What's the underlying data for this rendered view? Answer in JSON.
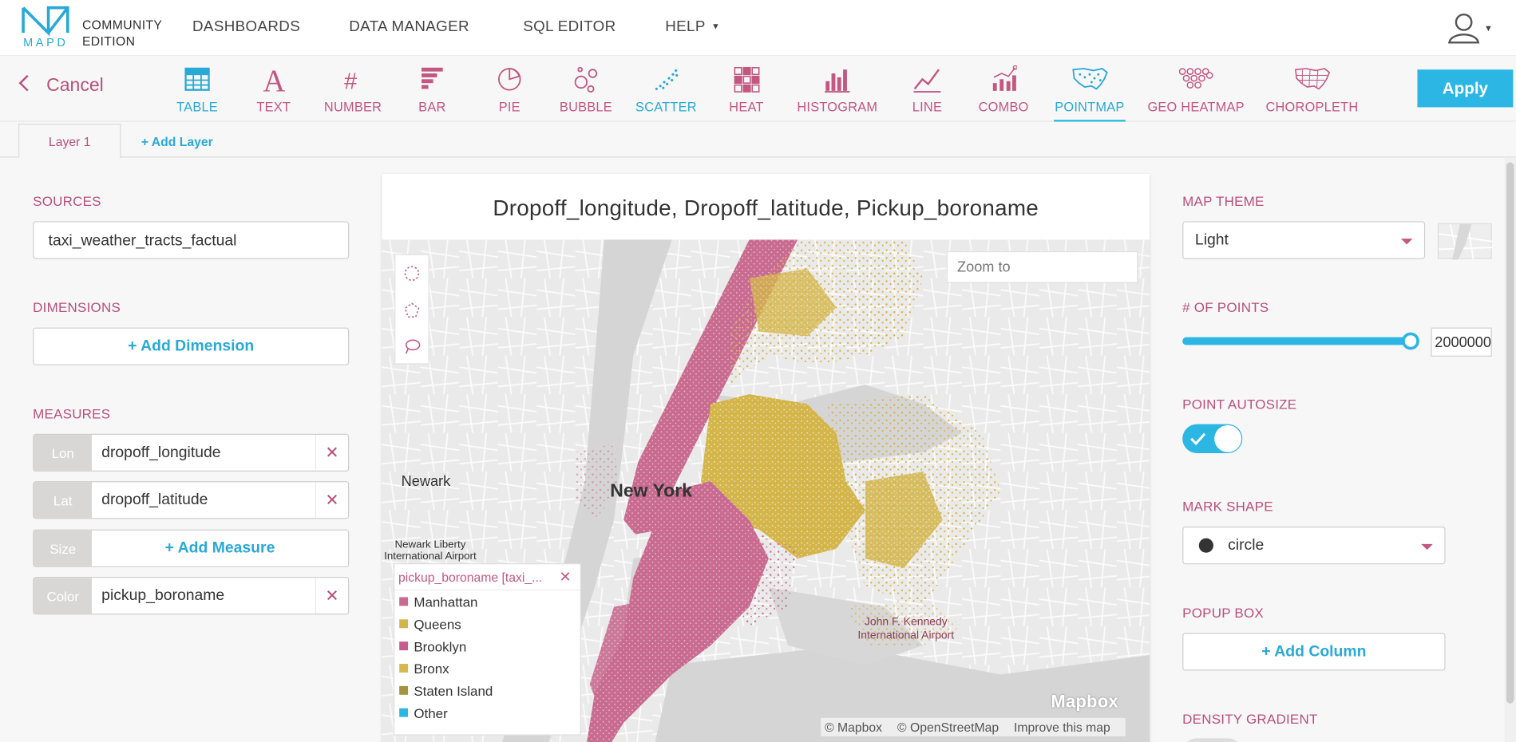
{
  "brand": {
    "logo_text": "MAPD",
    "edition_line1": "COMMUNITY",
    "edition_line2": "EDITION"
  },
  "nav": {
    "dashboards": "DASHBOARDS",
    "data_manager": "DATA MANAGER",
    "sql_editor": "SQL EDITOR",
    "help": "HELP"
  },
  "toolbar": {
    "cancel": "Cancel",
    "apply": "Apply",
    "chart_types": [
      "TABLE",
      "TEXT",
      "NUMBER",
      "BAR",
      "PIE",
      "BUBBLE",
      "SCATTER",
      "HEAT",
      "HISTOGRAM",
      "LINE",
      "COMBO",
      "POINTMAP",
      "GEO HEATMAP",
      "CHOROPLETH"
    ],
    "active": "POINTMAP"
  },
  "layers": {
    "tab": "Layer 1",
    "add": "+ Add Layer"
  },
  "left": {
    "sources_label": "SOURCES",
    "source": "taxi_weather_tracts_factual",
    "dimensions_label": "DIMENSIONS",
    "add_dimension": "+ Add Dimension",
    "measures_label": "MEASURES",
    "measures": [
      {
        "tag": "Lon",
        "value": "dropoff_longitude",
        "remove": "✕"
      },
      {
        "tag": "Lat",
        "value": "dropoff_latitude",
        "remove": "✕"
      },
      {
        "tag": "Size",
        "add": "+ Add Measure"
      },
      {
        "tag": "Color",
        "value": "pickup_boroname",
        "remove": "✕"
      }
    ]
  },
  "chart": {
    "title": "Dropoff_longitude,  Dropoff_latitude,  Pickup_boroname",
    "zoom_placeholder": "Zoom to",
    "labels": {
      "newark": "Newark",
      "ny": "New York",
      "ewr1": "Newark Liberty",
      "ewr2": "International Airport",
      "jfk1": "John F. Kennedy",
      "jfk2": "International Airport"
    },
    "legend": {
      "title": "pickup_boroname [taxi_...",
      "close": "✕",
      "items": [
        {
          "label": "Manhattan",
          "color": "#c96b90"
        },
        {
          "label": "Queens",
          "color": "#d4b54a"
        },
        {
          "label": "Brooklyn",
          "color": "#c65c8c"
        },
        {
          "label": "Bronx",
          "color": "#d6b84e"
        },
        {
          "label": "Staten Island",
          "color": "#a6913e"
        },
        {
          "label": "Other",
          "color": "#2bb6e3"
        }
      ]
    },
    "mapbox_logo": "Mapbox",
    "attribution": [
      "© Mapbox",
      "© OpenStreetMap",
      "Improve this map"
    ]
  },
  "right": {
    "map_theme_label": "MAP THEME",
    "map_theme": "Light",
    "points_label": "# OF POINTS",
    "points_value": "2000000",
    "points_fraction": 1.0,
    "autosize_label": "POINT AUTOSIZE",
    "autosize_on": true,
    "mark_shape_label": "MARK SHAPE",
    "mark_shape": "circle",
    "popup_label": "POPUP BOX",
    "add_column": "+ Add Column",
    "density_label": "DENSITY GRADIENT"
  },
  "colors": {
    "accent_blue": "#2bb6e3",
    "accent_pink": "#b8507a",
    "manhattan": "#c96b90",
    "queens": "#d4b54a"
  }
}
